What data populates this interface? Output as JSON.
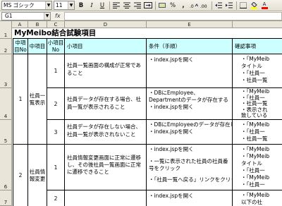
{
  "toolbar": {
    "font_name": "MS ゴシック",
    "font_size": "11",
    "bold": "B",
    "italic": "I",
    "underline": "U",
    "percent": "%",
    "comma": ",",
    "fill_color": "#ffff00",
    "font_color": "#ff0000"
  },
  "formula_bar": {
    "cell_ref": "G1",
    "fx": "fx",
    "value": ""
  },
  "columns": [
    "A",
    "B",
    "C",
    "D",
    "E"
  ],
  "rows": [
    "1",
    "2",
    "3",
    "4",
    "5",
    "6",
    "7"
  ],
  "sheet": {
    "title": "MyMeibo結合試験項目",
    "headers": {
      "mid_no": "中項目No",
      "mid": "中項目",
      "small_no": "小項目No",
      "small": "小項目",
      "condition": "条件（手順）",
      "confirm": "確認事項"
    },
    "groups": [
      {
        "no": "1",
        "name": "社員一覧表示"
      },
      {
        "no": "2",
        "name": "社員情報変更"
      }
    ],
    "items": [
      {
        "no": "1",
        "text": "社員一覧画面の構成が正常であること",
        "conditions": [
          "・index.jspを開く"
        ],
        "confirm": [
          "・「MyMeib",
          "タイトル",
          "・「社員一",
          "・社員一覧"
        ]
      },
      {
        "no": "2",
        "text": "社員データが存在する場合、社員一覧が表示されること",
        "conditions": [
          "・DBにEmployee、Departmentのデータが存在する",
          "・index.jspを開く"
        ],
        "confirm": [
          "・「MyMeib",
          "・「社員一",
          "・社員一覧",
          "・表示され",
          "致している"
        ]
      },
      {
        "no": "3",
        "text": "社員データが存在しない場合、社員一覧が表示されないこと",
        "conditions": [
          "・DBにEmployeeのデータが存在しない",
          "・index.jspを開く"
        ],
        "confirm": [
          "・「MyMeib",
          "・「社員一",
          "・社員一覧"
        ]
      },
      {
        "no": "1",
        "text": "社員情報変更画面に正常に遷移し、その後社員一覧画面に正常に遷移できること",
        "conditions": [
          "・index.jspを開く",
          "・一覧に表示された社員の社員番号をクリック",
          "・「社員一覧へ戻る」リンクをクリック"
        ],
        "confirm": [
          "・「MyMeib",
          "・「MyMeib",
          "タイトル",
          "・「社員一",
          "・「MyMeib",
          "・「社員一"
        ]
      },
      {
        "no": "2",
        "text": "",
        "conditions": [
          "・index.jspを開く"
        ],
        "confirm": [
          "・「MyMeib",
          "以下の社"
        ]
      }
    ]
  }
}
